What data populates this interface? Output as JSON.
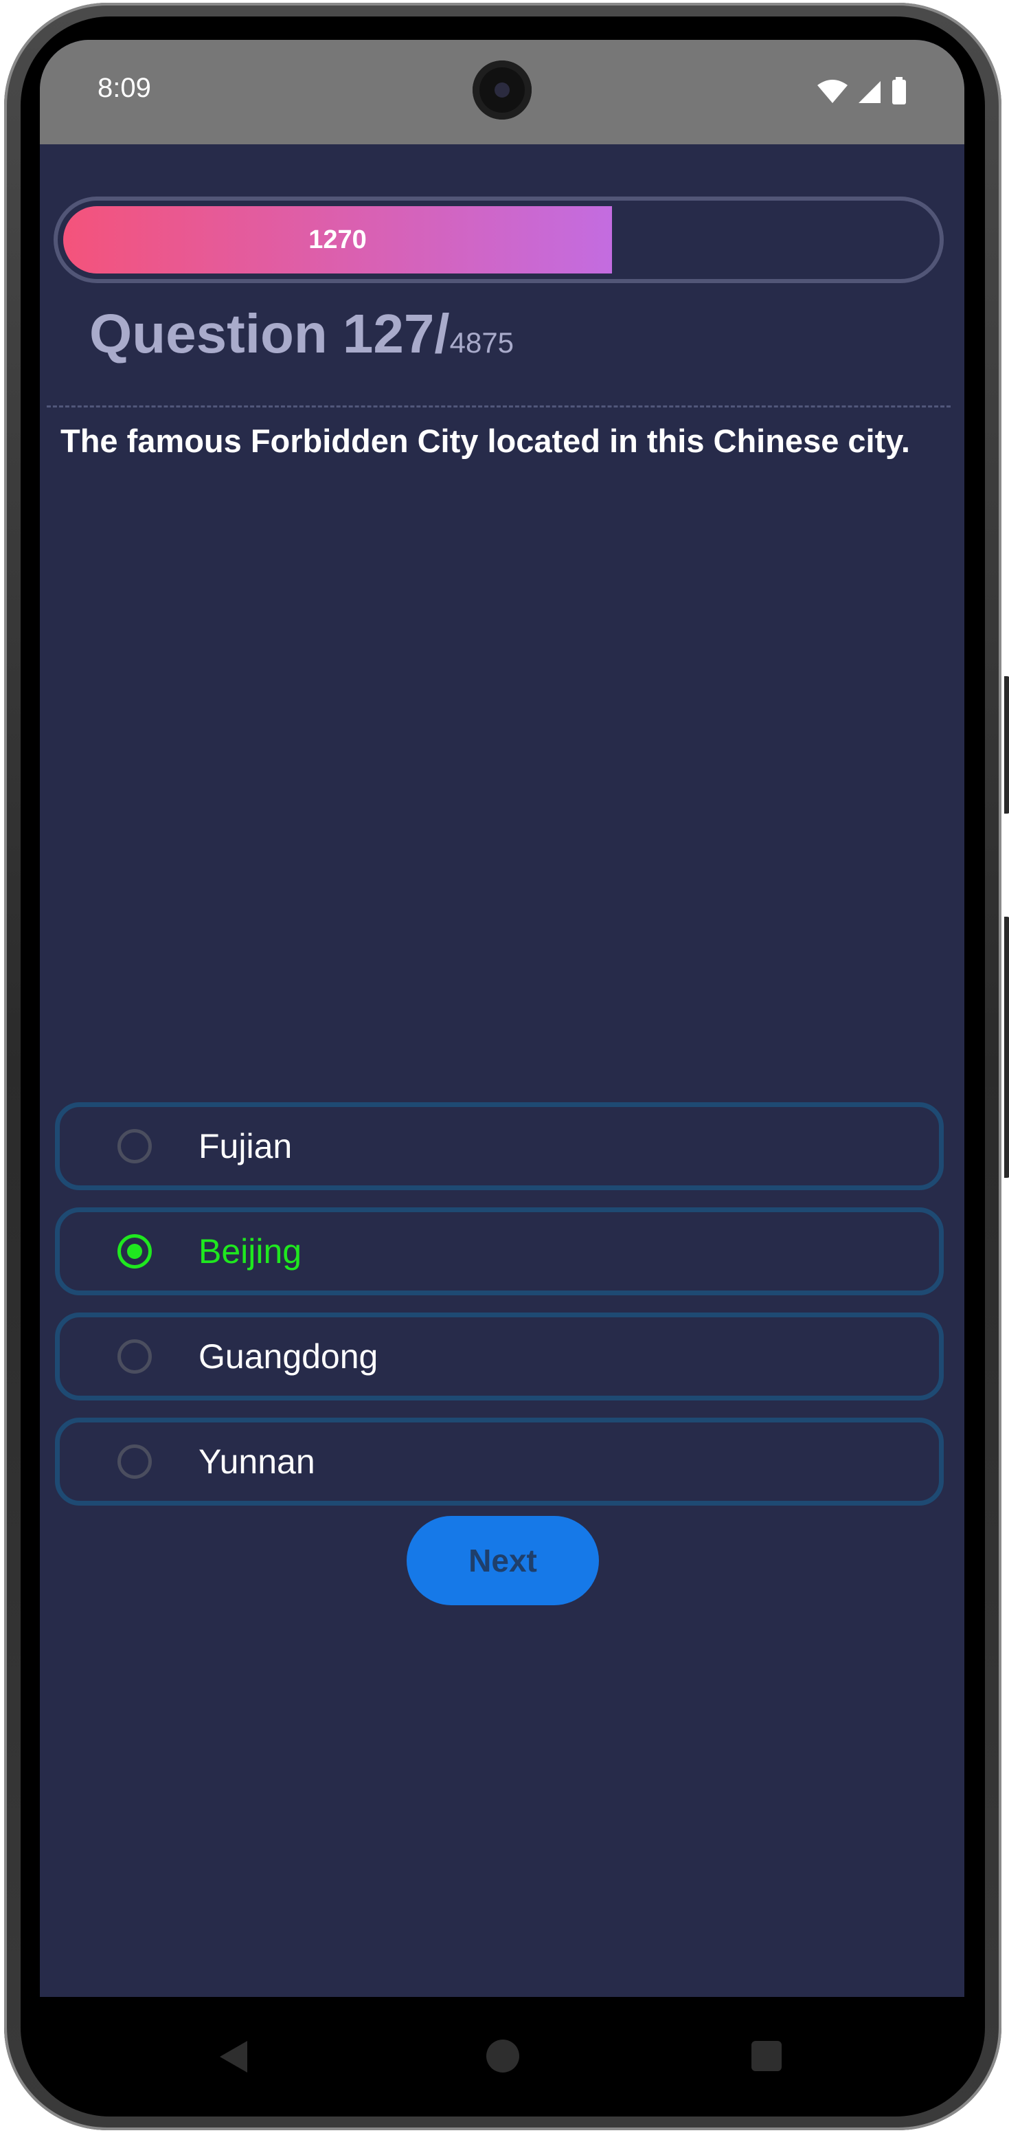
{
  "status_bar": {
    "time": "8:09",
    "icons": [
      "wifi-icon",
      "signal-icon",
      "battery-icon"
    ]
  },
  "progress": {
    "value_label": "1270",
    "fraction": 0.63,
    "gradient_start": "#f4537b",
    "gradient_end": "#c36ce0"
  },
  "question": {
    "number_label": "Question 127/",
    "total": "4875",
    "text": "The famous Forbidden City located in this Chinese city."
  },
  "options": [
    {
      "label": "Fujian",
      "selected": false
    },
    {
      "label": "Beijing",
      "selected": true
    },
    {
      "label": "Guangdong",
      "selected": false
    },
    {
      "label": "Yunnan",
      "selected": false
    }
  ],
  "next_button": {
    "label": "Next"
  },
  "navigation": {
    "icons": [
      "back-icon",
      "home-icon",
      "recents-icon"
    ]
  },
  "colors": {
    "background": "#272b4a",
    "option_border": "#1e4a73",
    "selected": "#1fe81f",
    "button": "#1679e8"
  }
}
